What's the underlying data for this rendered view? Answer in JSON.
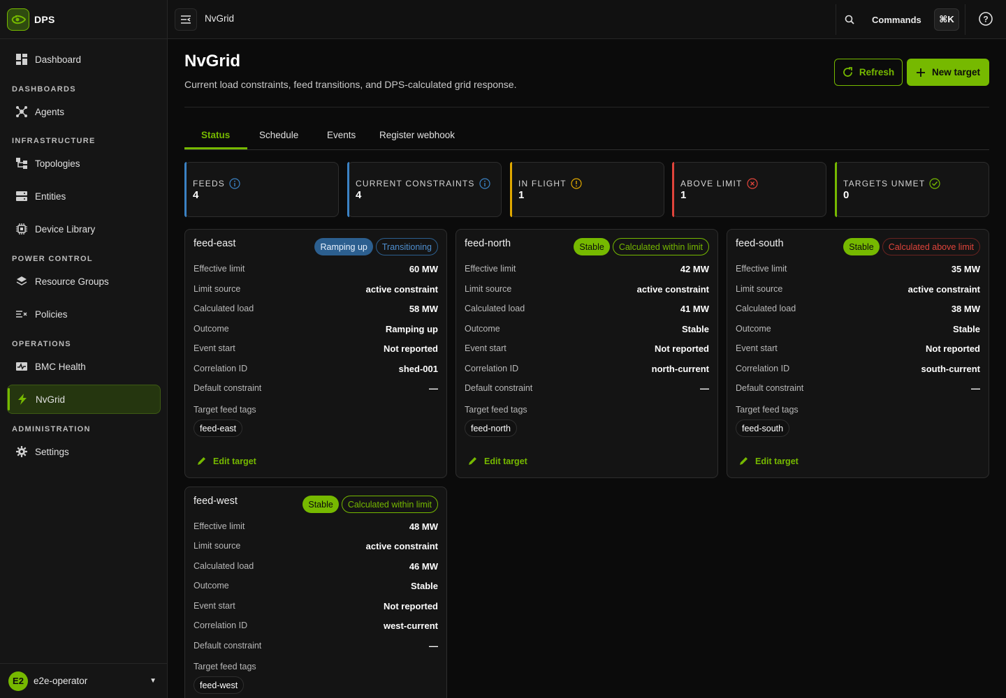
{
  "app": {
    "name": "DPS"
  },
  "sidebar": {
    "items": [
      {
        "label": "Dashboard"
      },
      {
        "label": "Agents"
      },
      {
        "label": "Topologies"
      },
      {
        "label": "Entities"
      },
      {
        "label": "Device Library"
      },
      {
        "label": "Resource Groups"
      },
      {
        "label": "Policies"
      },
      {
        "label": "BMC Health"
      },
      {
        "label": "NvGrid"
      },
      {
        "label": "Settings"
      }
    ],
    "sections": {
      "dashboards": "DASHBOARDS",
      "infrastructure": "INFRASTRUCTURE",
      "power_control": "POWER CONTROL",
      "operations": "OPERATIONS",
      "administration": "ADMINISTRATION"
    },
    "active": "NvGrid",
    "user": {
      "initials": "E2",
      "name": "e2e-operator"
    }
  },
  "topbar": {
    "title": "NvGrid",
    "commands_label": "Commands",
    "shortcut": "⌘K"
  },
  "page": {
    "title": "NvGrid",
    "subtitle": "Current load constraints, feed transitions, and DPS-calculated grid response.",
    "refresh_label": "Refresh",
    "new_target_label": "New target"
  },
  "tabs": [
    {
      "label": "Status",
      "active": true
    },
    {
      "label": "Schedule"
    },
    {
      "label": "Events"
    },
    {
      "label": "Register webhook"
    }
  ],
  "stats": [
    {
      "label": "FEEDS",
      "value": "4",
      "tone": "info",
      "icon": "info-icon"
    },
    {
      "label": "CURRENT CONSTRAINTS",
      "value": "4",
      "tone": "info",
      "icon": "info-icon"
    },
    {
      "label": "IN FLIGHT",
      "value": "1",
      "tone": "warn",
      "icon": "warning-icon"
    },
    {
      "label": "ABOVE LIMIT",
      "value": "1",
      "tone": "danger",
      "icon": "error-icon"
    },
    {
      "label": "TARGETS UNMET",
      "value": "0",
      "tone": "success",
      "icon": "check-icon"
    }
  ],
  "field_labels": {
    "effective_limit": "Effective limit",
    "limit_source": "Limit source",
    "calculated_load": "Calculated load",
    "outcome": "Outcome",
    "event_start": "Event start",
    "correlation_id": "Correlation ID",
    "default_constraint": "Default constraint",
    "target_feed_tags": "Target feed tags",
    "edit_target": "Edit target"
  },
  "feeds": [
    {
      "name": "feed-east",
      "badges": [
        {
          "text": "Ramping up",
          "style": "blue-fill"
        },
        {
          "text": "Transitioning",
          "style": "blue-outline"
        }
      ],
      "effective_limit": "60 MW",
      "limit_source": "active constraint",
      "calculated_load": "58 MW",
      "outcome": "Ramping up",
      "event_start": "Not reported",
      "correlation_id": "shed-001",
      "default_constraint": "—",
      "tag": "feed-east"
    },
    {
      "name": "feed-north",
      "badges": [
        {
          "text": "Stable",
          "style": "green-fill"
        },
        {
          "text": "Calculated within limit",
          "style": "green-outline"
        }
      ],
      "effective_limit": "42 MW",
      "limit_source": "active constraint",
      "calculated_load": "41 MW",
      "outcome": "Stable",
      "event_start": "Not reported",
      "correlation_id": "north-current",
      "default_constraint": "—",
      "tag": "feed-north"
    },
    {
      "name": "feed-south",
      "badges": [
        {
          "text": "Stable",
          "style": "green-fill"
        },
        {
          "text": "Calculated above limit",
          "style": "red-outline"
        }
      ],
      "effective_limit": "35 MW",
      "limit_source": "active constraint",
      "calculated_load": "38 MW",
      "outcome": "Stable",
      "event_start": "Not reported",
      "correlation_id": "south-current",
      "default_constraint": "—",
      "tag": "feed-south"
    },
    {
      "name": "feed-west",
      "badges": [
        {
          "text": "Stable",
          "style": "green-fill"
        },
        {
          "text": "Calculated within limit",
          "style": "green-outline"
        }
      ],
      "effective_limit": "48 MW",
      "limit_source": "active constraint",
      "calculated_load": "46 MW",
      "outcome": "Stable",
      "event_start": "Not reported",
      "correlation_id": "west-current",
      "default_constraint": "—",
      "tag": "feed-west"
    }
  ],
  "colors": {
    "accent": "#76b900",
    "info": "#3b82c4",
    "warning": "#e0a800",
    "danger": "#e0443b",
    "background": "#0b0b0b"
  }
}
